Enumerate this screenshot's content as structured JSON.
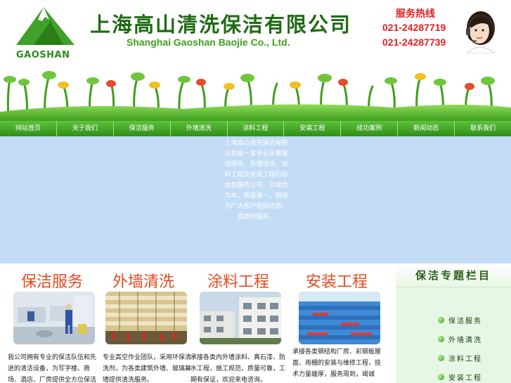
{
  "header": {
    "logo_text": "GAOSHAN",
    "company_cn": "上海高山清洗保洁有限公司",
    "company_en": "Shanghai Gaoshan Baojie Co., Ltd.",
    "hotline_label": "服务热线",
    "phones": [
      "021-24287719",
      "021-24287739"
    ]
  },
  "nav": {
    "items": [
      "网站首页",
      "关于我们",
      "保洁服务",
      "外墙清洗",
      "涂料工程",
      "安装工程",
      "成功案例",
      "新闻动态",
      "联系我们"
    ]
  },
  "intro": {
    "text": "上海高山清洗保洁有限公司是一家专业从事保洁服务、外墙清洗、涂料工程及安装工程的综合性服务公司，以诚信为本，质量第一，竭诚为广大客户提供优质、高效的服务。"
  },
  "services": [
    {
      "title": "保洁服务",
      "desc": "我公司拥有专业的保洁队伍和先进的清洁设备，为写字楼、商场、酒店、厂房提供全方位保洁服务。"
    },
    {
      "title": "外墙清洗",
      "desc": "专业高空作业团队，采用环保清洗剂，为各类建筑外墙、玻璃幕墙提供清洗服务。"
    },
    {
      "title": "涂料工程",
      "desc": "承接各类内外墙涂料、真石漆、防水工程，施工规范，质量可靠，工期有保证，欢迎来电咨询。"
    },
    {
      "title": "安装工程",
      "desc": "承接各类钢结构厂房、彩钢板屋面、雨棚的安装与维修工程，技术力量雄厚，服务周到，竭诚"
    }
  ],
  "sidebar": {
    "title": "保洁专题栏目",
    "items": [
      "保洁服务",
      "外墙清洗",
      "涂料工程",
      "安装工程"
    ]
  },
  "colors": {
    "brand_green": "#2f8e18",
    "title_orange": "#e64a1e",
    "hotline_red": "#e02020",
    "content_blue": "#c2dcf6"
  }
}
